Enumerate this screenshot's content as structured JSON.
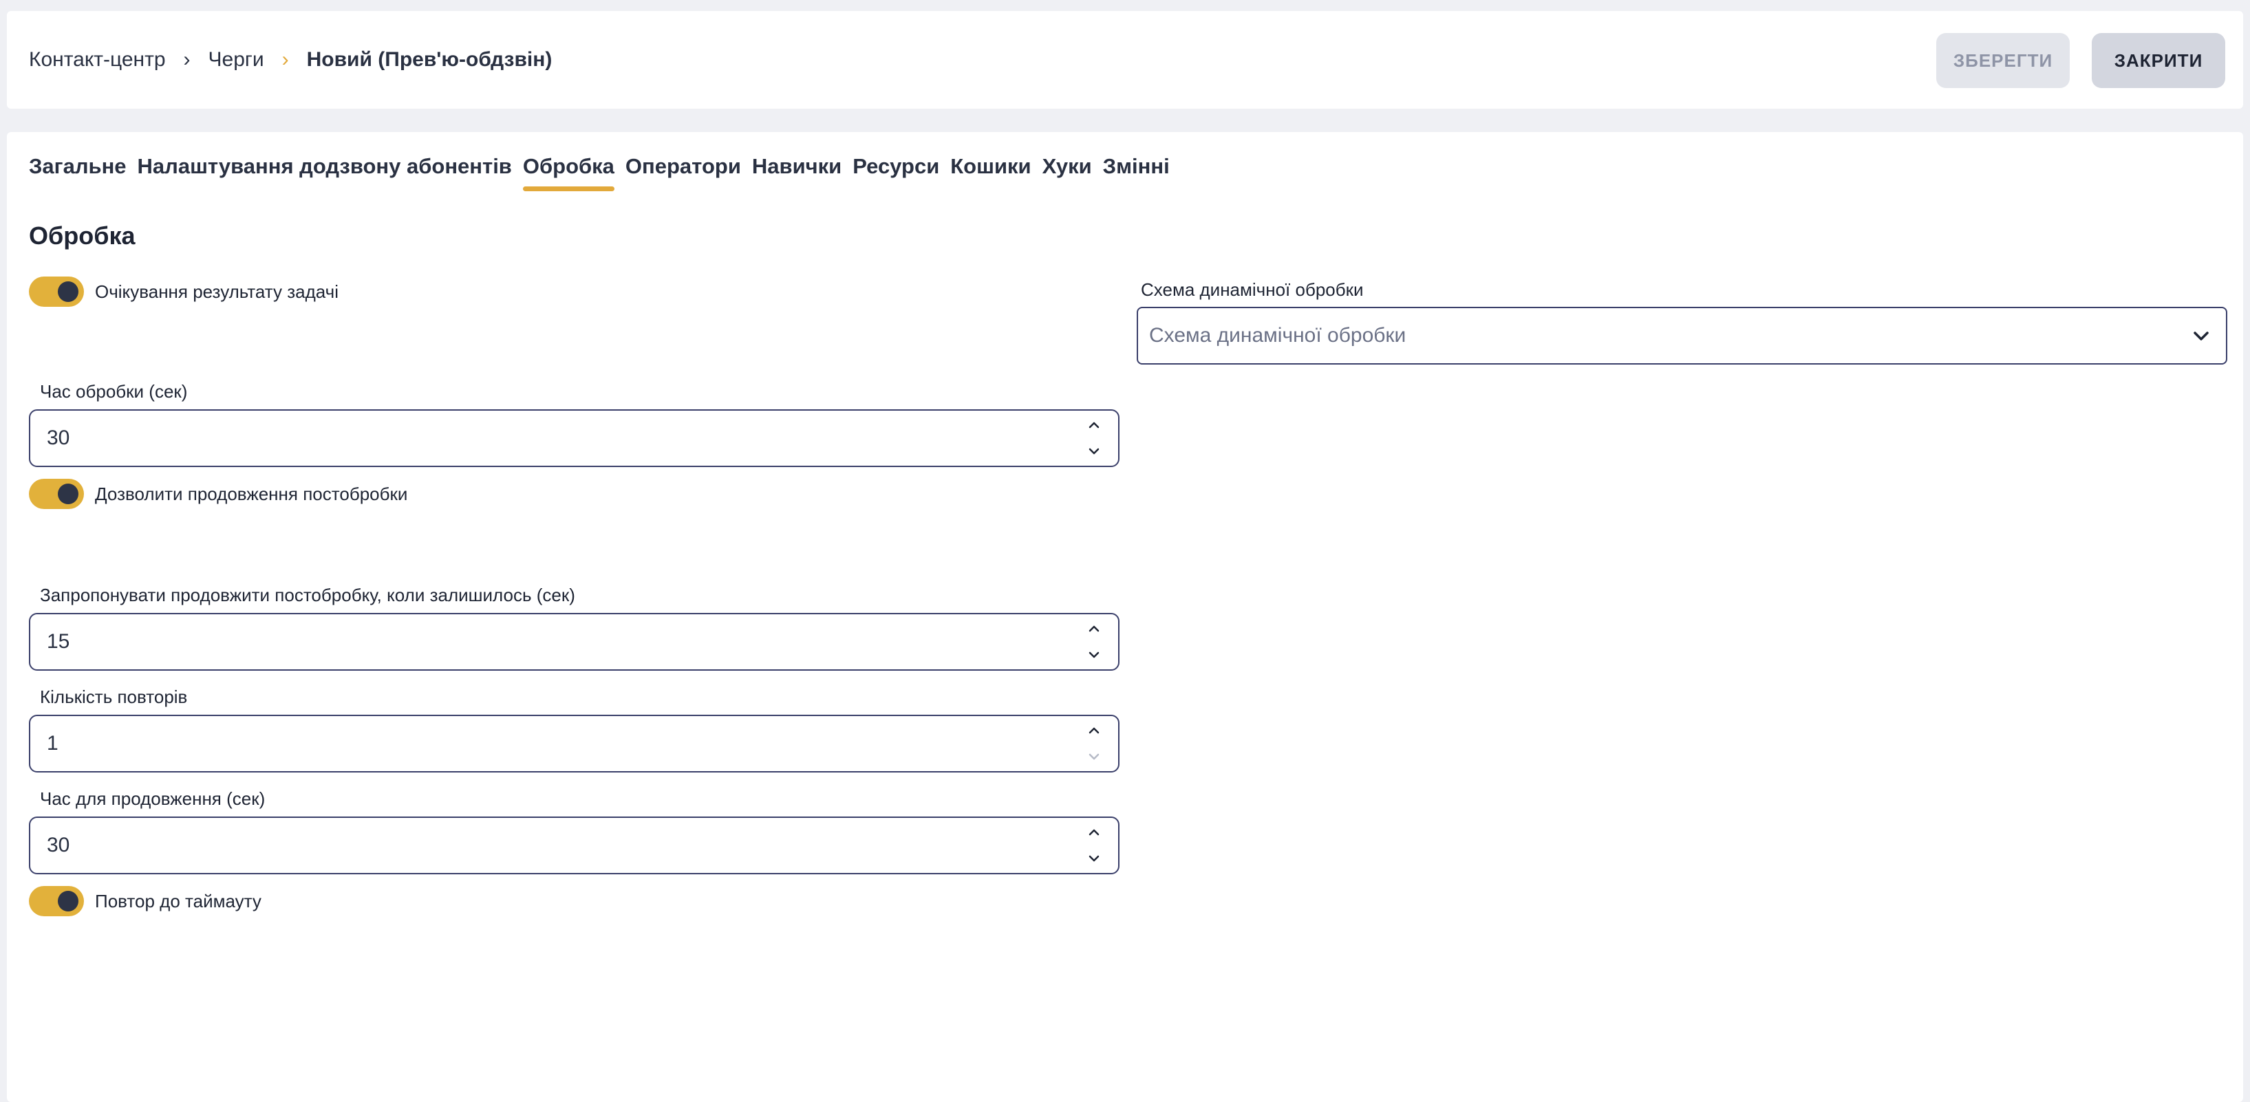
{
  "breadcrumb": {
    "items": [
      "Контакт-центр",
      "Черги"
    ],
    "current": "Новий (Прев'ю-обдзвін)"
  },
  "header": {
    "save_label": "ЗБЕРЕГТИ",
    "close_label": "ЗАКРИТИ"
  },
  "tabs": [
    {
      "label": "Загальне",
      "active": false
    },
    {
      "label": "Налаштування додзвону абонентів",
      "active": false
    },
    {
      "label": "Обробка",
      "active": true
    },
    {
      "label": "Оператори",
      "active": false
    },
    {
      "label": "Навички",
      "active": false
    },
    {
      "label": "Ресурси",
      "active": false
    },
    {
      "label": "Кошики",
      "active": false
    },
    {
      "label": "Хуки",
      "active": false
    },
    {
      "label": "Змінні",
      "active": false
    }
  ],
  "section": {
    "title": "Обробка"
  },
  "toggles": {
    "await_result": {
      "label": "Очікування результату задачі",
      "on": true
    },
    "allow_extend": {
      "label": "Дозволити продовження постобробки",
      "on": true
    },
    "repeat_timeout": {
      "label": "Повтор до таймауту",
      "on": true
    }
  },
  "fields": {
    "processing_time": {
      "label": "Час обробки (сек)",
      "value": "30"
    },
    "offer_extend": {
      "label": "Запропонувати продовжити постобробку, коли залишилось (сек)",
      "value": "15"
    },
    "repeat_count": {
      "label": "Кількість повторів",
      "value": "1"
    },
    "extend_time": {
      "label": "Час для продовження (сек)",
      "value": "30"
    }
  },
  "schema": {
    "label": "Схема динамічної обробки",
    "placeholder": "Схема динамічної обробки"
  },
  "colors": {
    "accent": "#e2a93b",
    "toggle_on": "#e2b13b",
    "border": "#3a3f6a"
  }
}
